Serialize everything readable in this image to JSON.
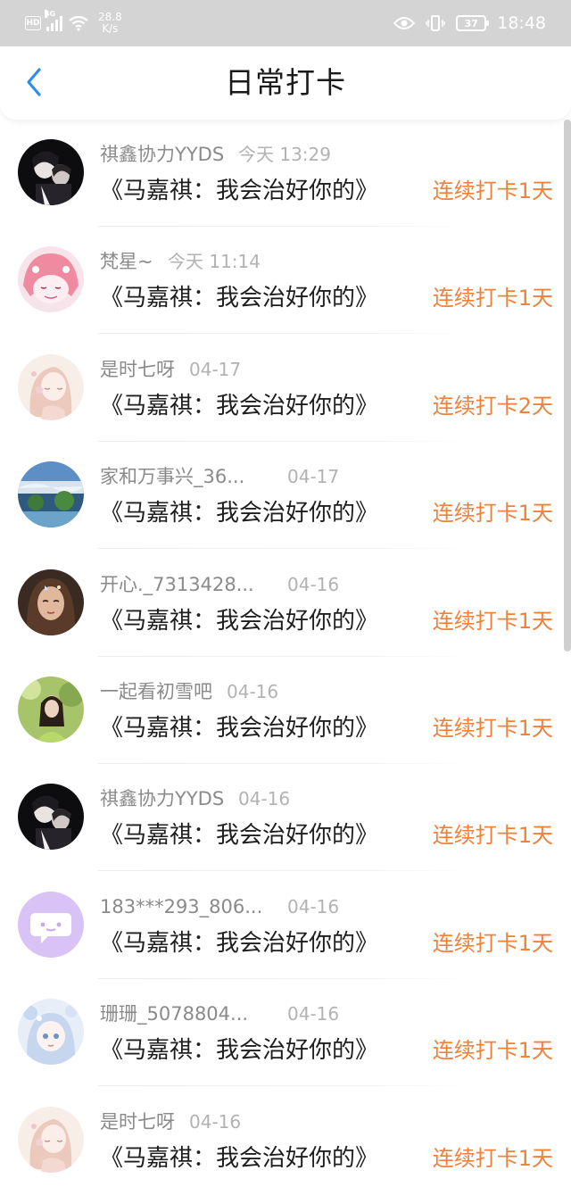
{
  "status_bar": {
    "hd": "HD",
    "network": "4G",
    "speed_value": "28.8",
    "speed_unit": "K/s",
    "battery": "37",
    "time": "18:48"
  },
  "header": {
    "title": "日常打卡"
  },
  "colors": {
    "accent_orange": "#f0813a",
    "back_arrow_blue": "#2d8cf0",
    "status_bar_bg": "#d4d4d4"
  },
  "checkins": [
    {
      "user": "祺鑫协力YYDS",
      "time": "今天 13:29",
      "work": "《马嘉祺：我会治好你的》",
      "streak": "连续打卡1天",
      "avatar": "couple-dark-photo"
    },
    {
      "user": "梵星~",
      "time": "今天 11:14",
      "work": "《马嘉祺：我会治好你的》",
      "streak": "连续打卡1天",
      "avatar": "pink-anime-girl"
    },
    {
      "user": "是时七呀",
      "time": "04-17",
      "work": "《马嘉祺：我会治好你的》",
      "streak": "连续打卡2天",
      "avatar": "pale-anime-girl"
    },
    {
      "user": "家和万事兴_36...",
      "time": "04-17",
      "work": "《马嘉祺：我会治好你的》",
      "streak": "连续打卡1天",
      "avatar": "landscape-photo"
    },
    {
      "user": "开心._7313428...",
      "time": "04-16",
      "work": "《马嘉祺：我会治好你的》",
      "streak": "连续打卡1天",
      "avatar": "girl-portrait"
    },
    {
      "user": "一起看初雪吧",
      "time": "04-16",
      "work": "《马嘉祺：我会治好你的》",
      "streak": "连续打卡1天",
      "avatar": "girl-green-photo"
    },
    {
      "user": "祺鑫协力YYDS",
      "time": "04-16",
      "work": "《马嘉祺：我会治好你的》",
      "streak": "连续打卡1天",
      "avatar": "couple-dark-photo"
    },
    {
      "user": "183***293_806...",
      "time": "04-16",
      "work": "《马嘉祺：我会治好你的》",
      "streak": "连续打卡1天",
      "avatar": "purple-chat-default"
    },
    {
      "user": "珊珊_5078804...",
      "time": "04-16",
      "work": "《马嘉祺：我会治好你的》",
      "streak": "连续打卡1天",
      "avatar": "blue-anime-girl"
    },
    {
      "user": "是时七呀",
      "time": "04-16",
      "work": "《马嘉祺：我会治好你的》",
      "streak": "连续打卡1天",
      "avatar": "pale-anime-girl"
    }
  ]
}
